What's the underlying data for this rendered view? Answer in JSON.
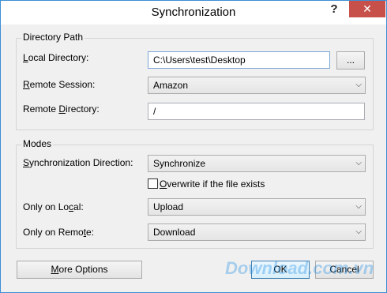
{
  "window": {
    "title": "Synchronization",
    "help": "?",
    "close": "✕"
  },
  "directory_path": {
    "group_title": "Directory Path",
    "local_label_pre": "",
    "local_label_ul": "L",
    "local_label_post": "ocal Directory:",
    "local_value": "C:\\Users\\test\\Desktop",
    "browse": "...",
    "remote_session_pre": "",
    "remote_session_ul": "R",
    "remote_session_post": "emote Session:",
    "remote_session_value": "Amazon",
    "remote_dir_pre": "Remote ",
    "remote_dir_ul": "D",
    "remote_dir_post": "irectory:",
    "remote_dir_value": "/"
  },
  "modes": {
    "group_title": "Modes",
    "direction_pre": "",
    "direction_ul": "S",
    "direction_post": "ynchronization Direction:",
    "direction_value": "Synchronize",
    "overwrite_pre": "",
    "overwrite_ul": "O",
    "overwrite_post": "verwrite if the file exists",
    "only_local_pre": "Only on Lo",
    "only_local_ul": "c",
    "only_local_post": "al:",
    "only_local_value": "Upload",
    "only_remote_pre": "Only on Remo",
    "only_remote_ul": "t",
    "only_remote_post": "e:",
    "only_remote_value": "Download"
  },
  "footer": {
    "more_pre": "",
    "more_ul": "M",
    "more_post": "ore Options",
    "ok": "OK",
    "cancel": "Cancel",
    "watermark": "Download.com.vn"
  }
}
